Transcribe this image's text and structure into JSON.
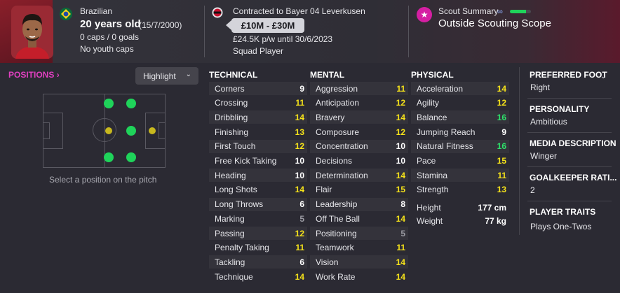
{
  "header": {
    "nationality": "Brazilian",
    "age": "20 years old",
    "dob": "(15/7/2000)",
    "caps": "0 caps / 0 goals",
    "youth_caps": "No youth caps",
    "contract": "Contracted to Bayer 04 Leverkusen",
    "value": "£10M - £30M",
    "wage": "£24.5K p/w until 30/6/2023",
    "squad_status": "Squad Player",
    "scout_title": "Scout Summary",
    "scout_scope": "Outside Scouting Scope",
    "scout_knowledge": 0.75
  },
  "positions": {
    "title": "POSITIONS",
    "highlight_label": "Highlight",
    "caption": "Select a position on the pitch"
  },
  "technical": {
    "title": "TECHNICAL",
    "attrs": [
      {
        "name": "Corners",
        "value": "9"
      },
      {
        "name": "Crossing",
        "value": "11"
      },
      {
        "name": "Dribbling",
        "value": "14"
      },
      {
        "name": "Finishing",
        "value": "13"
      },
      {
        "name": "First Touch",
        "value": "12"
      },
      {
        "name": "Free Kick Taking",
        "value": "10"
      },
      {
        "name": "Heading",
        "value": "10"
      },
      {
        "name": "Long Shots",
        "value": "14"
      },
      {
        "name": "Long Throws",
        "value": "6"
      },
      {
        "name": "Marking",
        "value": "5"
      },
      {
        "name": "Passing",
        "value": "12"
      },
      {
        "name": "Penalty Taking",
        "value": "11"
      },
      {
        "name": "Tackling",
        "value": "6"
      },
      {
        "name": "Technique",
        "value": "14"
      }
    ]
  },
  "mental": {
    "title": "MENTAL",
    "attrs": [
      {
        "name": "Aggression",
        "value": "11"
      },
      {
        "name": "Anticipation",
        "value": "12"
      },
      {
        "name": "Bravery",
        "value": "14"
      },
      {
        "name": "Composure",
        "value": "12"
      },
      {
        "name": "Concentration",
        "value": "10"
      },
      {
        "name": "Decisions",
        "value": "10"
      },
      {
        "name": "Determination",
        "value": "14"
      },
      {
        "name": "Flair",
        "value": "15"
      },
      {
        "name": "Leadership",
        "value": "8"
      },
      {
        "name": "Off The Ball",
        "value": "14"
      },
      {
        "name": "Positioning",
        "value": "5"
      },
      {
        "name": "Teamwork",
        "value": "11"
      },
      {
        "name": "Vision",
        "value": "14"
      },
      {
        "name": "Work Rate",
        "value": "14"
      }
    ]
  },
  "physical": {
    "title": "PHYSICAL",
    "attrs": [
      {
        "name": "Acceleration",
        "value": "14"
      },
      {
        "name": "Agility",
        "value": "12"
      },
      {
        "name": "Balance",
        "value": "16"
      },
      {
        "name": "Jumping Reach",
        "value": "9"
      },
      {
        "name": "Natural Fitness",
        "value": "16"
      },
      {
        "name": "Pace",
        "value": "15"
      },
      {
        "name": "Stamina",
        "value": "11"
      },
      {
        "name": "Strength",
        "value": "13"
      }
    ],
    "height_label": "Height",
    "height_value": "177 cm",
    "weight_label": "Weight",
    "weight_value": "77 kg"
  },
  "info": {
    "preferred_foot_label": "PREFERRED FOOT",
    "preferred_foot": "Right",
    "personality_label": "PERSONALITY",
    "personality": "Ambitious",
    "media_label": "MEDIA DESCRIPTION",
    "media": "Winger",
    "gk_rating_label": "GOALKEEPER RATI...",
    "gk_rating": "2",
    "traits_label": "PLAYER TRAITS",
    "traits": "Plays One-Twos"
  },
  "colors": {
    "accent": "#e040c0",
    "val_white": "#ffffff",
    "val_grey": "#9a9aa2",
    "val_yellow": "#f5e21a",
    "val_green": "#2ee06a",
    "dot_green": "#1fd35a",
    "dot_yellow": "#c8b81e"
  },
  "icons": {
    "flag": "brazil-flag-icon",
    "club": "leverkusen-crest-icon",
    "scout": "star-icon",
    "binoculars": "binoculars-icon"
  }
}
